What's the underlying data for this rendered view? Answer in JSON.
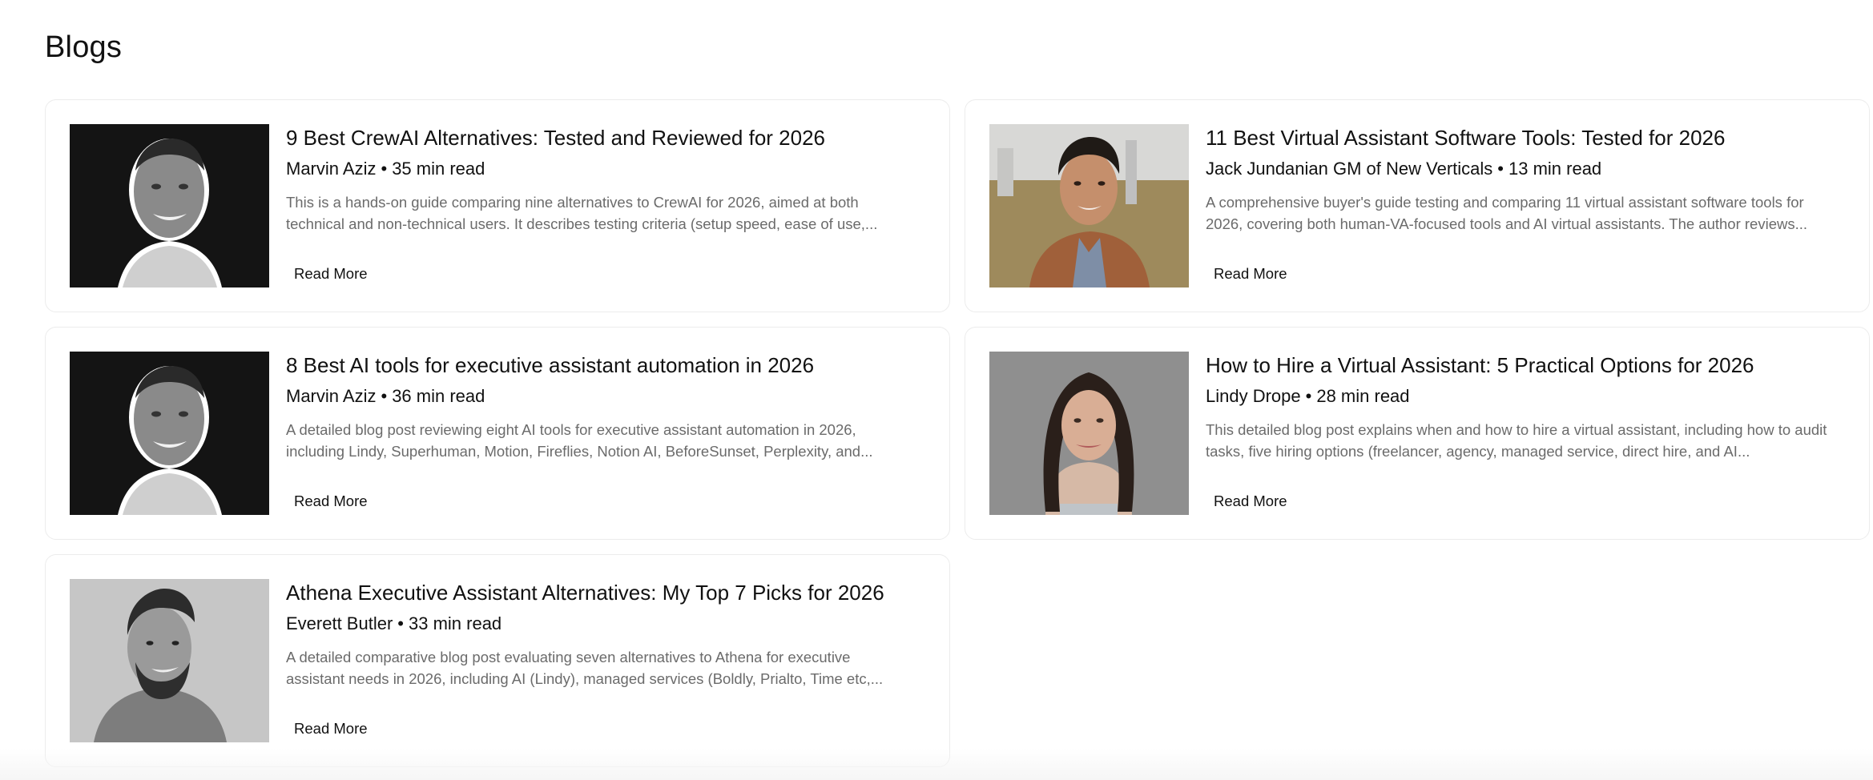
{
  "page": {
    "title": "Blogs"
  },
  "cards": [
    {
      "title": "9 Best CrewAI Alternatives: Tested and Reviewed for 2026",
      "author": "Marvin Aziz",
      "read_time": "35 min read",
      "description": "This is a hands-on guide comparing nine alternatives to CrewAI for 2026, aimed at both technical and non-technical users. It describes testing criteria (setup speed, ease of use,...",
      "read_more": "Read More",
      "image": "author-photo-marvin"
    },
    {
      "title": "11 Best Virtual Assistant Software Tools: Tested for 2026",
      "author": "Jack Jundanian GM of New Verticals",
      "read_time": "13 min read",
      "description": "A comprehensive buyer's guide testing and comparing 11 virtual assistant software tools for 2026, covering both human-VA-focused tools and AI virtual assistants. The author reviews...",
      "read_more": "Read More",
      "image": "author-photo-jack"
    },
    {
      "title": "8 Best AI tools for executive assistant automation in 2026",
      "author": "Marvin Aziz",
      "read_time": "36 min read",
      "description": "A detailed blog post reviewing eight AI tools for executive assistant automation in 2026, including Lindy, Superhuman, Motion, Fireflies, Notion AI, BeforeSunset, Perplexity, and...",
      "read_more": "Read More",
      "image": "author-photo-marvin"
    },
    {
      "title": "How to Hire a Virtual Assistant: 5 Practical Options for 2026",
      "author": "Lindy Drope",
      "read_time": "28 min read",
      "description": "This detailed blog post explains when and how to hire a virtual assistant, including how to audit tasks, five hiring options (freelancer, agency, managed service, direct hire, and AI...",
      "read_more": "Read More",
      "image": "author-photo-lindy"
    },
    {
      "title": "Athena Executive Assistant Alternatives: My Top 7 Picks for 2026",
      "author": "Everett Butler",
      "read_time": "33 min read",
      "description": "A detailed comparative blog post evaluating seven alternatives to Athena for executive assistant needs in 2026, including AI (Lindy), managed services (Boldly, Prialto, Time etc,...",
      "read_more": "Read More",
      "image": "author-photo-everett"
    }
  ],
  "separator": "•"
}
